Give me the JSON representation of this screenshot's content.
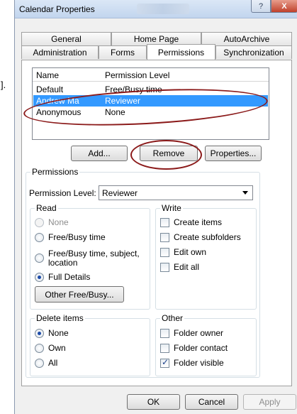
{
  "stray_text": "].",
  "window": {
    "title": "Calendar Properties",
    "help": "?",
    "close": "X"
  },
  "tabs_row1": [
    {
      "label": "General"
    },
    {
      "label": "Home Page"
    },
    {
      "label": "AutoArchive"
    }
  ],
  "tabs_row2": [
    {
      "label": "Administration"
    },
    {
      "label": "Forms"
    },
    {
      "label": "Permissions"
    },
    {
      "label": "Synchronization"
    }
  ],
  "permissions_list": {
    "headers": [
      "Name",
      "Permission Level"
    ],
    "rows": [
      {
        "name": "Default",
        "level": "Free/Busy time"
      },
      {
        "name": "Andrew Ma",
        "level": "Reviewer"
      },
      {
        "name": "Anonymous",
        "level": "None"
      }
    ]
  },
  "buttons": {
    "add": "Add...",
    "remove": "Remove",
    "properties": "Properties..."
  },
  "permissions": {
    "title": "Permissions",
    "level_label": "Permission Level:",
    "level_value": "Reviewer",
    "read": {
      "title": "Read",
      "none": "None",
      "free_busy": "Free/Busy time",
      "free_busy_subject": "Free/Busy time, subject,",
      "location": "location",
      "full_details": "Full Details",
      "other_button": "Other Free/Busy..."
    },
    "write": {
      "title": "Write",
      "create_items": "Create items",
      "create_subfolders": "Create subfolders",
      "edit_own": "Edit own",
      "edit_all": "Edit all"
    },
    "delete": {
      "title": "Delete items",
      "none": "None",
      "own": "Own",
      "all": "All"
    },
    "other": {
      "title": "Other",
      "folder_owner": "Folder owner",
      "folder_contact": "Folder contact",
      "folder_visible": "Folder visible"
    }
  },
  "footer": {
    "ok": "OK",
    "cancel": "Cancel",
    "apply": "Apply"
  },
  "colors": {
    "selection": "#3399ff",
    "annotation": "#8b1a1a"
  }
}
